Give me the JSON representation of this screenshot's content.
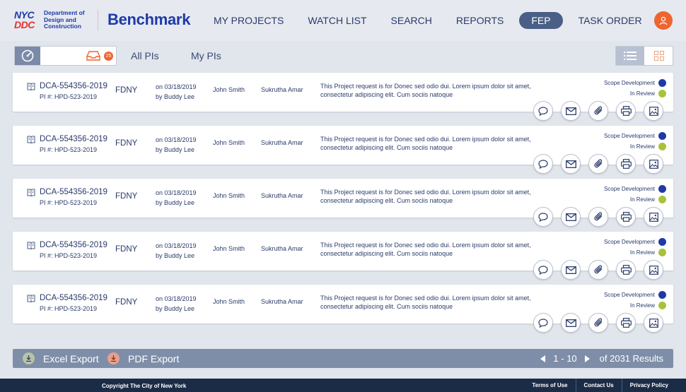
{
  "header": {
    "logo_nyc": "NYC",
    "logo_ddc": "DDC",
    "logo_text": "Department of Design and Construction",
    "brand": "Benchmark",
    "nav": [
      "MY PROJECTS",
      "WATCH LIST",
      "SEARCH",
      "REPORTS",
      "FEP",
      "TASK ORDER"
    ],
    "active_nav": "FEP"
  },
  "filters": {
    "inbox_count": "25",
    "tabs": [
      "All PIs",
      "My PIs"
    ]
  },
  "rows": [
    {
      "id": "DCA-554356-2019",
      "pi": "PI #: HPD-523-2019",
      "agency": "FDNY",
      "date": "on 03/18/2019",
      "by": "by Buddy Lee",
      "person1": "John Smith",
      "person2": "Sukrutha Amar",
      "desc": "This Project request is for Donec sed odio dui. Lorem ipsum dolor sit amet, consectetur adipiscing elit. Cum sociis natoque",
      "status1": "Scope Development",
      "status2": "In Review"
    },
    {
      "id": "DCA-554356-2019",
      "pi": "PI #: HPD-523-2019",
      "agency": "FDNY",
      "date": "on 03/18/2019",
      "by": "by Buddy Lee",
      "person1": "John Smith",
      "person2": "Sukrutha Amar",
      "desc": "This Project request is for Donec sed odio dui. Lorem ipsum dolor sit amet, consectetur adipiscing elit. Cum sociis natoque",
      "status1": "Scope Development",
      "status2": "In Review"
    },
    {
      "id": "DCA-554356-2019",
      "pi": "PI #: HPD-523-2019",
      "agency": "FDNY",
      "date": "on 03/18/2019",
      "by": "by Buddy Lee",
      "person1": "John Smith",
      "person2": "Sukrutha Amar",
      "desc": "This Project request is for Donec sed odio dui. Lorem ipsum dolor sit amet, consectetur adipiscing elit. Cum sociis natoque",
      "status1": "Scope Development",
      "status2": "In Review"
    },
    {
      "id": "DCA-554356-2019",
      "pi": "PI #: HPD-523-2019",
      "agency": "FDNY",
      "date": "on 03/18/2019",
      "by": "by Buddy Lee",
      "person1": "John Smith",
      "person2": "Sukrutha Amar",
      "desc": "This Project request is for Donec sed odio dui. Lorem ipsum dolor sit amet, consectetur adipiscing elit. Cum sociis natoque",
      "status1": "Scope Development",
      "status2": "In Review"
    },
    {
      "id": "DCA-554356-2019",
      "pi": "PI #: HPD-523-2019",
      "agency": "FDNY",
      "date": "on 03/18/2019",
      "by": "by Buddy Lee",
      "person1": "John Smith",
      "person2": "Sukrutha Amar",
      "desc": "This Project request is for Donec sed odio dui. Lorem ipsum dolor sit amet, consectetur adipiscing elit. Cum sociis natoque",
      "status1": "Scope Development",
      "status2": "In Review"
    }
  ],
  "row_actions": [
    "comment-icon",
    "mail-icon",
    "attachment-icon",
    "print-icon",
    "image-icon"
  ],
  "bottom": {
    "excel_export": "Excel Export",
    "pdf_export": "PDF Export",
    "range": "1 - 10",
    "total": "of 2031 Results"
  },
  "footer": {
    "copyright": "Copyright The City of New York",
    "links": [
      "Terms of Use",
      "Contact Us",
      "Privacy Policy"
    ]
  },
  "colors": {
    "brand_blue": "#1e3aa8",
    "accent_orange": "#f0642f",
    "status_blue": "#1e3aa8",
    "status_green": "#a8c23a",
    "footer_bg": "#1b2c47"
  }
}
